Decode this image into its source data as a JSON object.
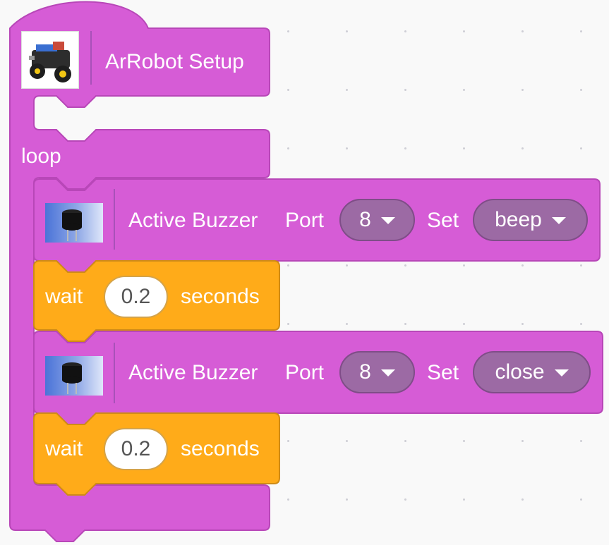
{
  "colors": {
    "looks_block": "#d65cd6",
    "looks_border": "#b847b8",
    "control_block": "#ffab19",
    "control_border": "#cf8b17",
    "dropdown_fill": "#9c6aa4"
  },
  "setup_block": {
    "icon": "robot-car-icon",
    "label": "ArRobot Setup"
  },
  "loop_block": {
    "label": "loop"
  },
  "statements": [
    {
      "type": "buzzer",
      "icon": "buzzer-icon",
      "label": "Active Buzzer",
      "port_label": "Port",
      "port_value": "8",
      "set_label": "Set",
      "set_value": "beep"
    },
    {
      "type": "wait",
      "wait_label": "wait",
      "seconds_value": "0.2",
      "seconds_label": "seconds"
    },
    {
      "type": "buzzer",
      "icon": "buzzer-icon",
      "label": "Active Buzzer",
      "port_label": "Port",
      "port_value": "8",
      "set_label": "Set",
      "set_value": "close"
    },
    {
      "type": "wait",
      "wait_label": "wait",
      "seconds_value": "0.2",
      "seconds_label": "seconds"
    }
  ]
}
